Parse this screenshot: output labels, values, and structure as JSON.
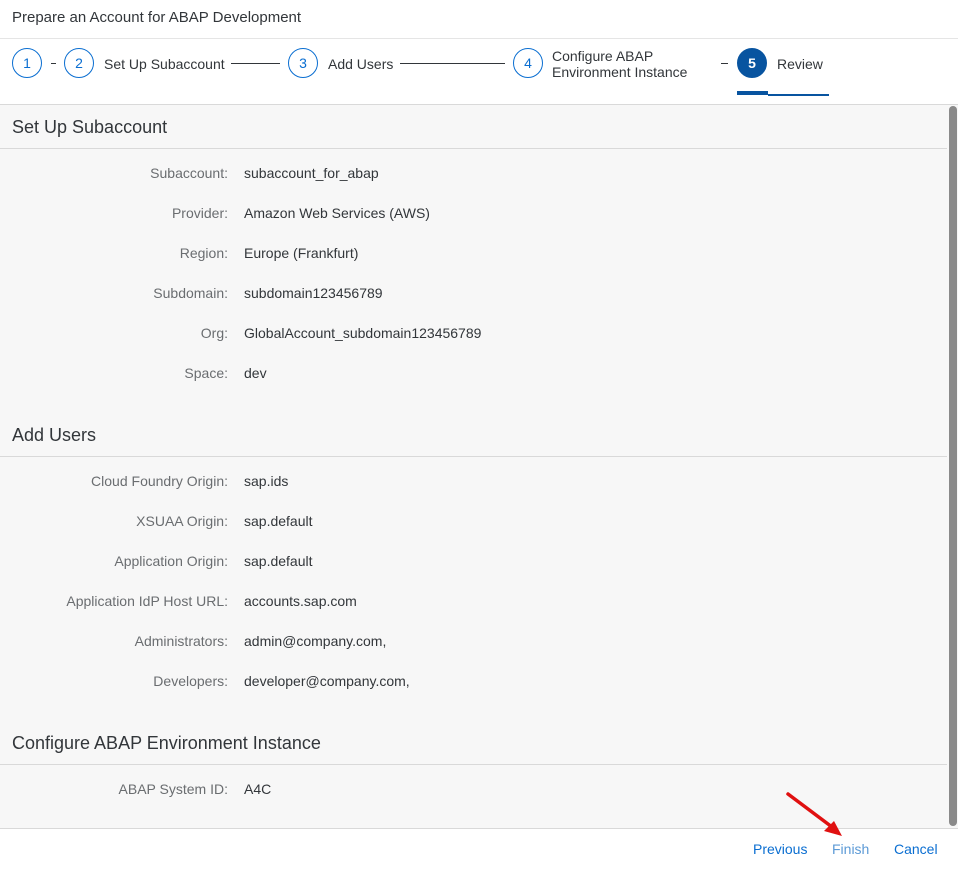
{
  "window": {
    "title": "Prepare an Account for ABAP Development"
  },
  "wizard": {
    "steps": [
      {
        "number": "1",
        "label": ""
      },
      {
        "number": "2",
        "label": "Set Up Subaccount"
      },
      {
        "number": "3",
        "label": "Add Users"
      },
      {
        "number": "4",
        "label_line1": "Configure ABAP",
        "label_line2": "Environment Instance"
      },
      {
        "number": "5",
        "label": "Review"
      }
    ],
    "accent_color": "#0854a0"
  },
  "sections": {
    "subaccount": {
      "title": "Set Up Subaccount",
      "rows": [
        {
          "label": "Subaccount:",
          "value": "subaccount_for_abap"
        },
        {
          "label": "Provider:",
          "value": "Amazon Web Services (AWS)"
        },
        {
          "label": "Region:",
          "value": "Europe (Frankfurt)"
        },
        {
          "label": "Subdomain:",
          "value": "subdomain123456789"
        },
        {
          "label": "Org:",
          "value": "GlobalAccount_subdomain123456789"
        },
        {
          "label": "Space:",
          "value": "dev"
        }
      ]
    },
    "users": {
      "title": "Add Users",
      "rows": [
        {
          "label": "Cloud Foundry Origin:",
          "value": "sap.ids"
        },
        {
          "label": "XSUAA Origin:",
          "value": "sap.default"
        },
        {
          "label": "Application Origin:",
          "value": "sap.default"
        },
        {
          "label": "Application IdP Host URL:",
          "value": "accounts.sap.com"
        },
        {
          "label": "Administrators:",
          "value": "admin@company.com,"
        },
        {
          "label": "Developers:",
          "value": "developer@company.com,"
        }
      ]
    },
    "abap": {
      "title": "Configure ABAP Environment Instance",
      "rows": [
        {
          "label": "ABAP System ID:",
          "value": "A4C"
        }
      ]
    }
  },
  "footer": {
    "previous_label": "Previous",
    "finish_label": "Finish",
    "cancel_label": "Cancel"
  }
}
